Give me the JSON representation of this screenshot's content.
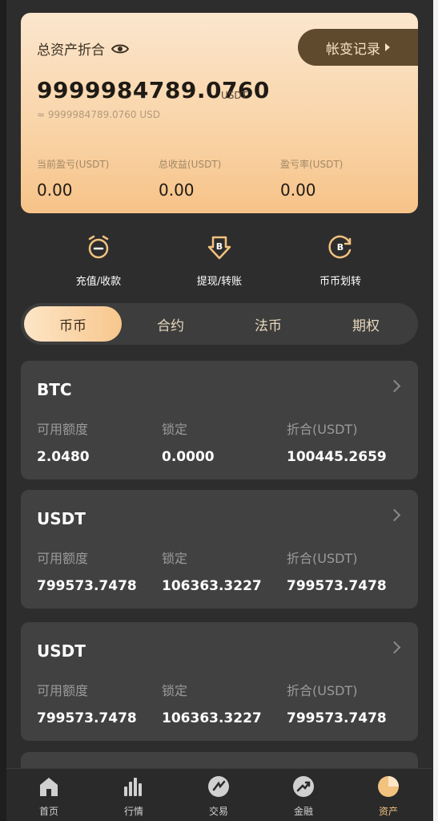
{
  "asset_card": {
    "title": "总资产折合",
    "ledger_button": "帐变记录",
    "total_amount": "9999984789.0760",
    "total_unit": "USDT",
    "approx": "≈ 9999984789.0760 USD",
    "stats": [
      {
        "label": "当前盈亏(USDT)",
        "value": "0.00"
      },
      {
        "label": "总收益(USDT)",
        "value": "0.00"
      },
      {
        "label": "盈亏率(USDT)",
        "value": "0.00"
      }
    ]
  },
  "actions": [
    {
      "label": "充值/收款",
      "icon": "deposit-icon"
    },
    {
      "label": "提现/转账",
      "icon": "withdraw-icon"
    },
    {
      "label": "币币划转",
      "icon": "transfer-icon"
    }
  ],
  "tabs": [
    "币币",
    "合约",
    "法币",
    "期权"
  ],
  "coins": [
    {
      "name": "BTC",
      "available_label": "可用额度",
      "available": "2.0480",
      "locked_label": "锁定",
      "locked": "0.0000",
      "converted_label": "折合(USDT)",
      "converted": "100445.2659"
    },
    {
      "name": "USDT",
      "available_label": "可用额度",
      "available": "799573.7478",
      "locked_label": "锁定",
      "locked": "106363.3227",
      "converted_label": "折合(USDT)",
      "converted": "799573.7478"
    },
    {
      "name": "USDT",
      "available_label": "可用额度",
      "available": "799573.7478",
      "locked_label": "锁定",
      "locked": "106363.3227",
      "converted_label": "折合(USDT)",
      "converted": "799573.7478"
    }
  ],
  "nav": [
    {
      "label": "首页",
      "icon": "home-icon"
    },
    {
      "label": "行情",
      "icon": "market-chart-icon"
    },
    {
      "label": "交易",
      "icon": "trade-icon"
    },
    {
      "label": "金融",
      "icon": "finance-icon"
    },
    {
      "label": "资产",
      "icon": "assets-pie-icon"
    }
  ],
  "colors": {
    "accent": "#f7c78d",
    "card": "#414141",
    "background": "#2d2d2d",
    "nav_active": "#f2c27f"
  }
}
